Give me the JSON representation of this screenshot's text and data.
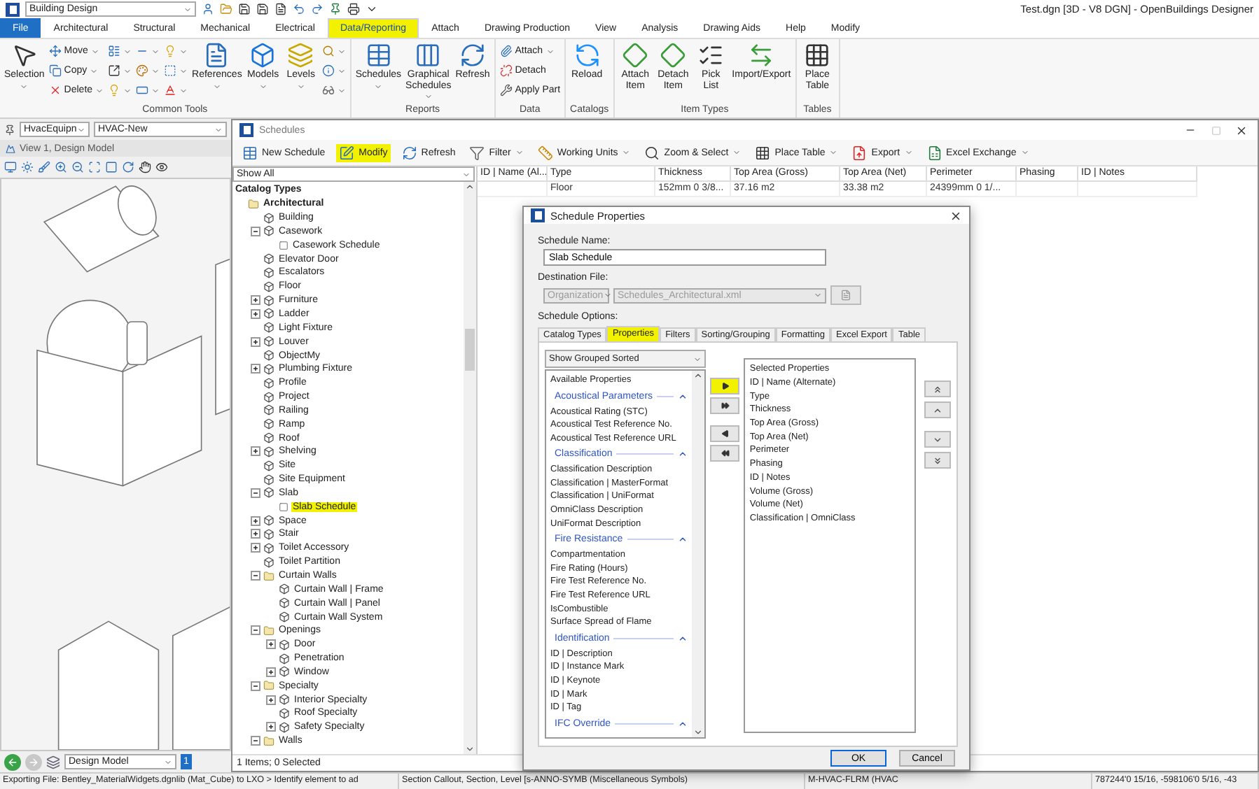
{
  "app": {
    "workflow": "Building Design",
    "title": "Test.dgn [3D - V8 DGN] - OpenBuildings Designer"
  },
  "ribbon": {
    "tabs": [
      {
        "label": "File",
        "kind": "file",
        "selected": false,
        "highlighted": false
      },
      {
        "label": "Architectural",
        "kind": "tab",
        "selected": false,
        "highlighted": false
      },
      {
        "label": "Structural",
        "kind": "tab",
        "selected": false,
        "highlighted": false
      },
      {
        "label": "Mechanical",
        "kind": "tab",
        "selected": false,
        "highlighted": false
      },
      {
        "label": "Electrical",
        "kind": "tab",
        "selected": false,
        "highlighted": false
      },
      {
        "label": "Data/Reporting",
        "kind": "tab",
        "selected": true,
        "highlighted": true
      },
      {
        "label": "Attach",
        "kind": "tab",
        "selected": false,
        "highlighted": false
      },
      {
        "label": "Drawing Production",
        "kind": "tab",
        "selected": false,
        "highlighted": false
      },
      {
        "label": "View",
        "kind": "tab",
        "selected": false,
        "highlighted": false
      },
      {
        "label": "Analysis",
        "kind": "tab",
        "selected": false,
        "highlighted": false
      },
      {
        "label": "Drawing Aids",
        "kind": "tab",
        "selected": false,
        "highlighted": false
      },
      {
        "label": "Help",
        "kind": "tab",
        "selected": false,
        "highlighted": false
      },
      {
        "label": "Modify",
        "kind": "tab",
        "selected": false,
        "highlighted": false
      }
    ],
    "groups": [
      {
        "label": "Common Tools",
        "columns": [
          {
            "kind": "large",
            "label": "Selection",
            "menu": true
          },
          {
            "kind": "stack",
            "entries": [
              {
                "label": "Move",
                "menu": true
              },
              {
                "label": "Copy",
                "menu": true
              },
              {
                "label": "Delete",
                "menu": true
              }
            ]
          },
          {
            "kind": "stack",
            "entries": [
              {
                "menu": true
              },
              {
                "menu": true
              },
              {
                "menu": true
              }
            ]
          },
          {
            "kind": "stack",
            "entries": [
              {
                "menu": true
              },
              {
                "menu": true
              },
              {
                "menu": true
              }
            ]
          },
          {
            "kind": "stack",
            "entries": [
              {
                "menu": true
              },
              {
                "menu": true
              },
              {
                "menu": true
              }
            ]
          },
          {
            "kind": "large",
            "label": "References",
            "menu": true
          },
          {
            "kind": "large",
            "label": "Models",
            "menu": true
          },
          {
            "kind": "large",
            "label": "Levels",
            "menu": true
          },
          {
            "kind": "stack",
            "entries": [
              {
                "menu": true
              },
              {
                "menu": true
              },
              {
                "menu": true
              }
            ]
          }
        ]
      },
      {
        "label": "Reports",
        "columns": [
          {
            "kind": "large",
            "label": "Schedules",
            "menu": true
          },
          {
            "kind": "large",
            "label": "Graphical Schedules",
            "menu": true
          },
          {
            "kind": "large",
            "label": "Refresh",
            "menu": false
          }
        ]
      },
      {
        "label": "Data",
        "columns": [
          {
            "kind": "stack",
            "entries": [
              {
                "label": "Attach",
                "menu": true
              },
              {
                "label": "Detach",
                "menu": false
              },
              {
                "label": "Apply Part",
                "menu": false
              }
            ]
          }
        ]
      },
      {
        "label": "Catalogs",
        "columns": [
          {
            "kind": "large",
            "label": "Reload",
            "menu": false
          }
        ]
      },
      {
        "label": "Item Types",
        "columns": [
          {
            "kind": "large",
            "label": "Attach Item",
            "menu": false
          },
          {
            "kind": "large",
            "label": "Detach Item",
            "menu": false
          },
          {
            "kind": "large",
            "label": "Pick List",
            "menu": false
          },
          {
            "kind": "large",
            "label": "Import/Export",
            "menu": false
          }
        ]
      },
      {
        "label": "Tables",
        "columns": [
          {
            "kind": "large",
            "label": "Place Table",
            "menu": false
          }
        ]
      }
    ]
  },
  "view": {
    "level_combo": "HvacEquipn",
    "model_combo": "HVAC-New",
    "title": "View 1, Design Model",
    "model_select": "Design Model",
    "view_number": "1"
  },
  "schedules": {
    "title": "Schedules",
    "toolbar": [
      {
        "label": "New Schedule",
        "menu": false,
        "highlighted": false
      },
      {
        "label": "Modify",
        "menu": false,
        "highlighted": true
      },
      {
        "label": "Refresh",
        "menu": false,
        "highlighted": false
      },
      {
        "label": "Filter",
        "menu": true,
        "highlighted": false
      },
      {
        "label": "Working Units",
        "menu": true,
        "highlighted": false
      },
      {
        "label": "Zoom & Select",
        "menu": true,
        "highlighted": false
      },
      {
        "label": "Place Table",
        "menu": true,
        "highlighted": false
      },
      {
        "label": "Export",
        "menu": true,
        "highlighted": false
      },
      {
        "label": "Excel Exchange",
        "menu": true,
        "highlighted": false
      }
    ],
    "filter_combo": "Show All",
    "tree_title": "Catalog Types",
    "tree": [
      {
        "label": "Architectural",
        "kind": "folder",
        "highlighted": false,
        "children": [
          {
            "label": "Building",
            "kind": "type",
            "highlighted": false
          },
          {
            "label": "Casework",
            "kind": "type",
            "expanded": true,
            "highlighted": false,
            "children": [
              {
                "label": "Casework Schedule",
                "kind": "schedule",
                "highlighted": false
              }
            ]
          },
          {
            "label": "Elevator Door",
            "kind": "type",
            "highlighted": false
          },
          {
            "label": "Escalators",
            "kind": "type",
            "highlighted": false
          },
          {
            "label": "Floor",
            "kind": "type",
            "highlighted": false
          },
          {
            "label": "Furniture",
            "kind": "type",
            "expanded": false,
            "highlighted": false
          },
          {
            "label": "Ladder",
            "kind": "type",
            "expanded": false,
            "highlighted": false
          },
          {
            "label": "Light Fixture",
            "kind": "type",
            "highlighted": false
          },
          {
            "label": "Louver",
            "kind": "type",
            "expanded": false,
            "highlighted": false
          },
          {
            "label": "ObjectMy",
            "kind": "type",
            "highlighted": false
          },
          {
            "label": "Plumbing Fixture",
            "kind": "type",
            "expanded": false,
            "highlighted": false
          },
          {
            "label": "Profile",
            "kind": "type",
            "highlighted": false
          },
          {
            "label": "Project",
            "kind": "type",
            "highlighted": false
          },
          {
            "label": "Railing",
            "kind": "type",
            "highlighted": false
          },
          {
            "label": "Ramp",
            "kind": "type",
            "highlighted": false
          },
          {
            "label": "Roof",
            "kind": "type",
            "highlighted": false
          },
          {
            "label": "Shelving",
            "kind": "type",
            "expanded": false,
            "highlighted": false
          },
          {
            "label": "Site",
            "kind": "type",
            "highlighted": false
          },
          {
            "label": "Site Equipment",
            "kind": "type",
            "highlighted": false
          },
          {
            "label": "Slab",
            "kind": "type",
            "expanded": true,
            "highlighted": false,
            "children": [
              {
                "label": "Slab Schedule",
                "kind": "schedule",
                "highlighted": true
              }
            ]
          },
          {
            "label": "Space",
            "kind": "type",
            "expanded": false,
            "highlighted": false
          },
          {
            "label": "Stair",
            "kind": "type",
            "expanded": false,
            "highlighted": false
          },
          {
            "label": "Toilet Accessory",
            "kind": "type",
            "expanded": false,
            "highlighted": false
          },
          {
            "label": "Toilet Partition",
            "kind": "type",
            "highlighted": false
          },
          {
            "label": "Curtain Walls",
            "kind": "folder",
            "expanded": true,
            "highlighted": false,
            "children": [
              {
                "label": "Curtain Wall | Frame",
                "kind": "type",
                "highlighted": false
              },
              {
                "label": "Curtain Wall | Panel",
                "kind": "type",
                "highlighted": false
              },
              {
                "label": "Curtain Wall System",
                "kind": "type",
                "highlighted": false
              }
            ]
          },
          {
            "label": "Openings",
            "kind": "folder",
            "expanded": true,
            "highlighted": false,
            "children": [
              {
                "label": "Door",
                "kind": "type",
                "expanded": false,
                "highlighted": false
              },
              {
                "label": "Penetration",
                "kind": "type",
                "highlighted": false
              },
              {
                "label": "Window",
                "kind": "type",
                "expanded": false,
                "highlighted": false
              }
            ]
          },
          {
            "label": "Specialty",
            "kind": "folder",
            "expanded": true,
            "highlighted": false,
            "children": [
              {
                "label": "Interior Specialty",
                "kind": "type",
                "expanded": false,
                "highlighted": false
              },
              {
                "label": "Roof Specialty",
                "kind": "type",
                "highlighted": false
              },
              {
                "label": "Safety Specialty",
                "kind": "type",
                "expanded": false,
                "highlighted": false
              }
            ]
          },
          {
            "label": "Walls",
            "kind": "folder",
            "expanded": true,
            "highlighted": false
          }
        ]
      }
    ],
    "table": {
      "columns": [
        "ID | Name (Al...",
        "Type",
        "Thickness",
        "Top Area (Gross)",
        "Top Area (Net)",
        "Perimeter",
        "Phasing",
        "ID | Notes"
      ],
      "rows": [
        {
          "cells": [
            null,
            "Floor",
            "152mm 0 3/8...",
            "37.16 m2",
            "33.38 m2",
            "24399mm 0 1/...",
            null,
            null
          ]
        }
      ]
    },
    "footer": "1 Items; 0 Selected"
  },
  "dialog": {
    "title": "Schedule Properties",
    "name_label": "Schedule Name:",
    "name_value": "Slab Schedule",
    "dest_label": "Destination File:",
    "dest_scope": "Organization",
    "dest_file": "Schedules_Architectural.xml",
    "dest_disabled": true,
    "options_label": "Schedule Options:",
    "tabs": [
      {
        "label": "Catalog Types",
        "selected": false,
        "highlighted": false
      },
      {
        "label": "Properties",
        "selected": true,
        "highlighted": true
      },
      {
        "label": "Filters",
        "selected": false,
        "highlighted": false
      },
      {
        "label": "Sorting/Grouping",
        "selected": false,
        "highlighted": false
      },
      {
        "label": "Formatting",
        "selected": false,
        "highlighted": false
      },
      {
        "label": "Excel Export",
        "selected": false,
        "highlighted": false
      },
      {
        "label": "Table",
        "selected": false,
        "highlighted": false
      }
    ],
    "grouping": "Show Grouped Sorted",
    "available": {
      "title": "Available Properties",
      "groups": [
        {
          "label": "Acoustical Parameters",
          "expanded": true,
          "items": [
            "Acoustical Rating (STC)",
            "Acoustical Test Reference No.",
            "Acoustical Test Reference URL"
          ]
        },
        {
          "label": "Classification",
          "expanded": true,
          "items": [
            "Classification Description",
            "Classification | MasterFormat",
            "Classification | UniFormat",
            "OmniClass Description",
            "UniFormat Description"
          ]
        },
        {
          "label": "Fire Resistance",
          "expanded": true,
          "items": [
            "Compartmentation",
            "Fire Rating (Hours)",
            "Fire Test Reference No.",
            "Fire Test Reference URL",
            "IsCombustible",
            "Surface Spread of Flame"
          ]
        },
        {
          "label": "Identification",
          "expanded": true,
          "items": [
            "ID | Description",
            "ID | Instance Mark",
            "ID | Keynote",
            "ID | Mark",
            "ID | Tag"
          ]
        },
        {
          "label": "IFC Override",
          "expanded": true
        }
      ]
    },
    "selected": {
      "title": "Selected Properties",
      "items": [
        "ID | Name (Alternate)",
        "Type",
        "Thickness",
        "Top Area (Gross)",
        "Top Area (Net)",
        "Perimeter",
        "Phasing",
        "ID | Notes",
        "Volume (Gross)",
        "Volume (Net)",
        "Classification | OmniClass"
      ]
    },
    "transfer_buttons": [
      {
        "kind": "add",
        "highlighted": true
      },
      {
        "kind": "add_all",
        "highlighted": false
      },
      {
        "kind": "remove",
        "highlighted": false
      },
      {
        "kind": "remove_all",
        "highlighted": false
      }
    ],
    "order_buttons": [
      {
        "kind": "top"
      },
      {
        "kind": "up"
      },
      {
        "kind": "down"
      },
      {
        "kind": "bottom"
      }
    ],
    "buttons": [
      {
        "label": "OK",
        "default": true
      },
      {
        "label": "Cancel",
        "default": false
      }
    ]
  },
  "status_bar": [
    "Exporting File: Bentley_MaterialWidgets.dgnlib (Mat_Cube) to LXO > Identify element to ad",
    "Section Callout, Section, Level [s-ANNO-SYMB (Miscellaneous Symbols)",
    "M-HVAC-FLRM (HVAC",
    "787244'0 15/16, -598106'0 5/16, -43"
  ]
}
